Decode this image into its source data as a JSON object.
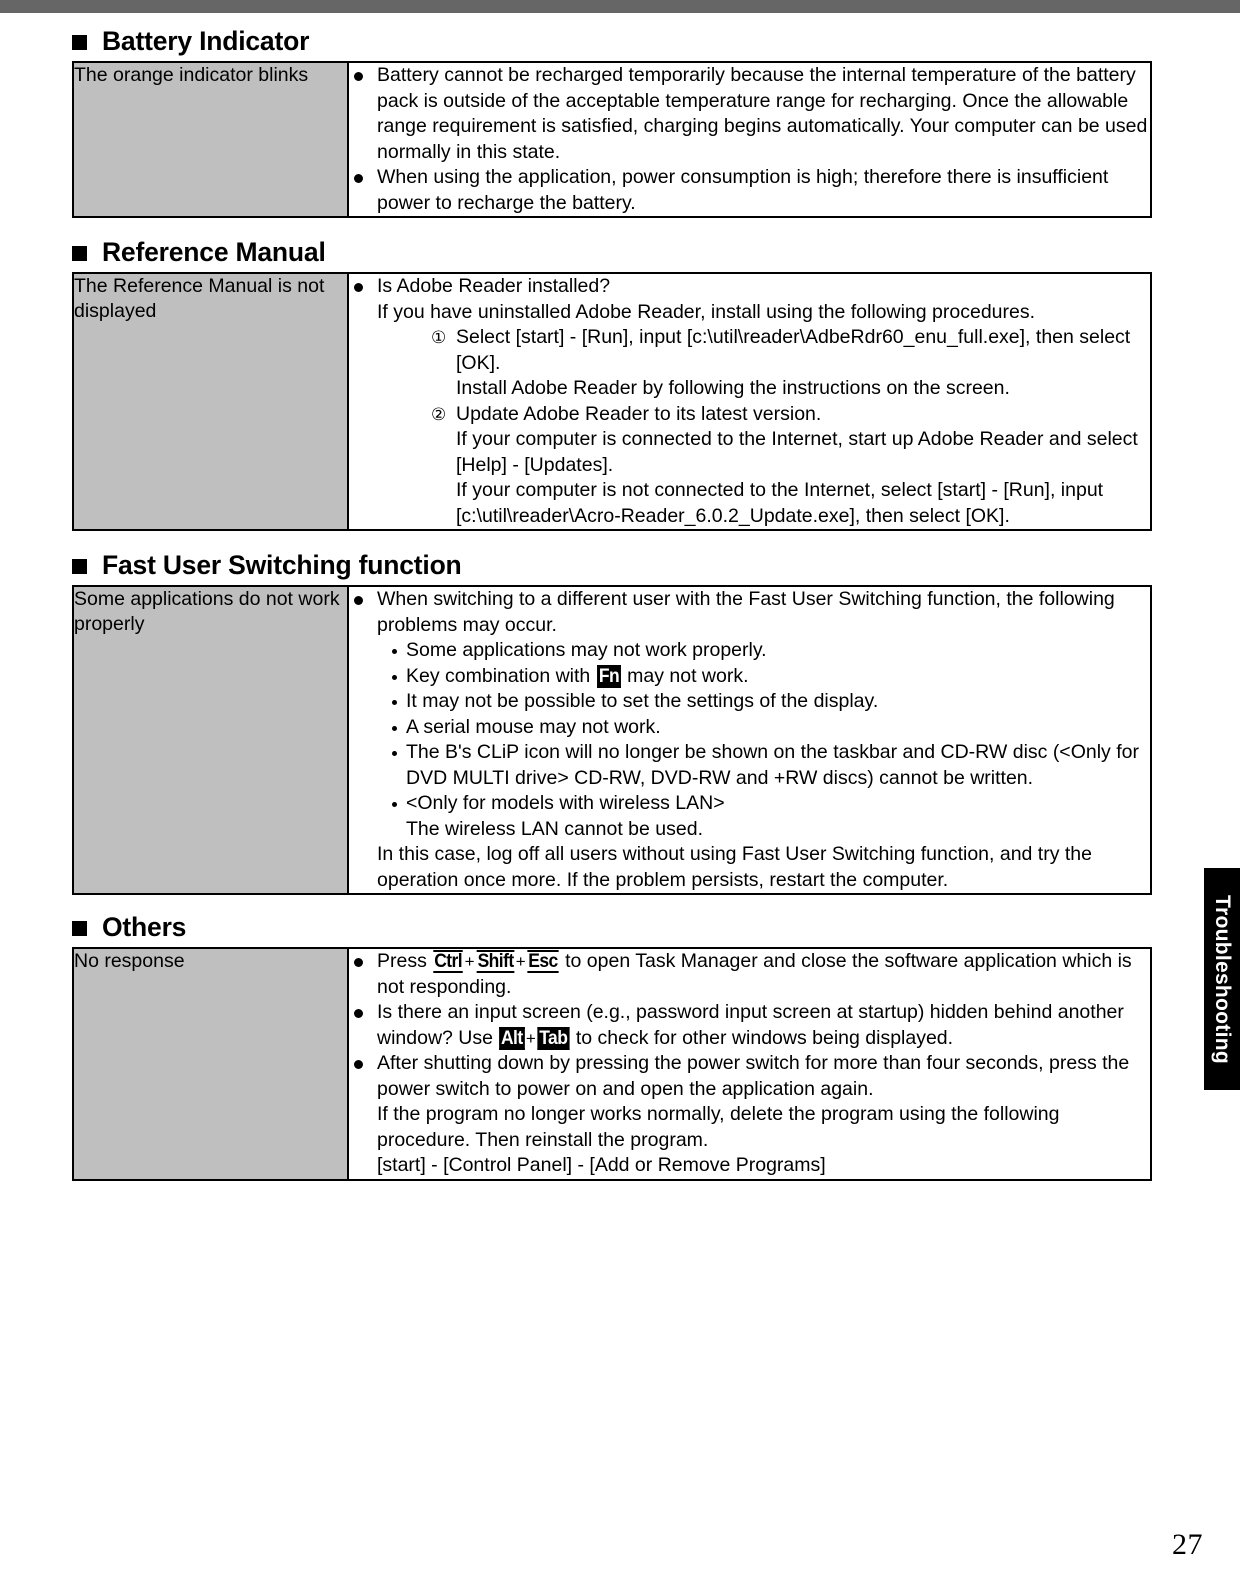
{
  "document": {
    "page_number": "27",
    "side_tab_label": "Troubleshooting"
  },
  "sections": [
    {
      "heading": "Battery Indicator",
      "symptom": "The orange indicator blinks",
      "bullets": [
        "Battery cannot be recharged temporarily because the internal temperature of the battery pack is outside of the acceptable temperature range for recharging. Once the allowable range  requirement is satisfied, charging begins automatically.  Your computer can be used normally in this state.",
        "When using the application, power consumption is high; therefore there is insufficient power to recharge the battery."
      ]
    },
    {
      "heading": "Reference Manual",
      "symptom": "The Reference Manual is not displayed",
      "bullet_main": "Is Adobe Reader installed?",
      "bullet_sub": "If you have uninstalled Adobe Reader, install using the following procedures.",
      "steps": [
        {
          "marker": "①",
          "lines": [
            "Select [start] - [Run], input [c:\\util\\reader\\AdbeRdr60_enu_full.exe], then select [OK].",
            "Install Adobe Reader by following the instructions on the screen."
          ]
        },
        {
          "marker": "②",
          "lines": [
            "Update Adobe Reader to its latest version.",
            "If your computer is connected to the Internet, start up Adobe Reader and select [Help] - [Updates].",
            "If your computer is not connected to the Internet, select [start] - [Run], input [c:\\util\\reader\\Acro-Reader_6.0.2_Update.exe], then select [OK]."
          ]
        }
      ]
    },
    {
      "heading": "Fast User Switching function",
      "symptom": "Some applications do not work properly",
      "bullet_main": "When switching to a different user with the Fast User Switching function, the following problems may occur.",
      "sub_bullets": [
        {
          "pre": "Some applications may not work properly.",
          "key": "",
          "post": ""
        },
        {
          "pre": "Key combination with ",
          "key": "Fn",
          "post": " may not work."
        },
        {
          "pre": "It may not be possible to set the settings of the display.",
          "key": "",
          "post": ""
        },
        {
          "pre": "A serial mouse may not work.",
          "key": "",
          "post": ""
        },
        {
          "pre": "The B's CLiP icon will no longer be shown on the taskbar and CD-RW disc (<Only for DVD MULTI drive> CD-RW, DVD-RW and +RW discs) cannot be written.",
          "key": "",
          "post": ""
        },
        {
          "pre": "<Only for models with wireless LAN>\nThe wireless LAN cannot be used.",
          "key": "",
          "post": ""
        }
      ],
      "closing": "In this case, log off all users without using Fast User Switching function, and try the operation once more. If the problem persists, restart the computer."
    },
    {
      "heading": "Others",
      "symptom": "No response",
      "others_bullets": {
        "b1_pre": "Press ",
        "b1_keys": [
          "Ctrl",
          "Shift",
          "Esc"
        ],
        "b1_post": " to open Task Manager and close the software application which is not responding.",
        "b2_pre": "Is there an input screen (e.g., password input screen at startup) hidden behind another window? Use ",
        "b2_keys": [
          "Alt",
          "Tab"
        ],
        "b2_post": " to check for other windows being displayed.",
        "b3_line1": "After shutting down by pressing the power switch for more than four seconds, press the power switch to power on and open the application again.",
        "b3_line2": "If the program no longer works normally, delete the program using the following procedure.  Then reinstall the program.",
        "b3_line3": "[start] - [Control Panel] - [Add or Remove Programs]"
      }
    }
  ]
}
